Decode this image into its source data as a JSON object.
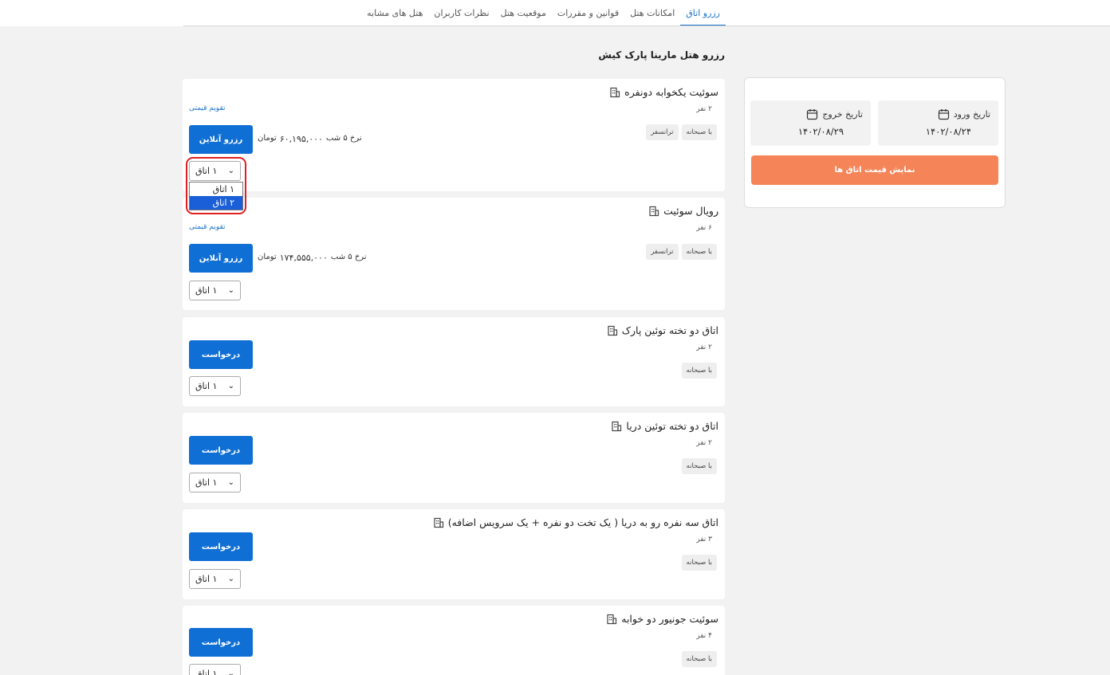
{
  "tabs": [
    {
      "label": "رزرو اتاق",
      "active": true
    },
    {
      "label": "امکانات هتل"
    },
    {
      "label": "قوانین و مقررات"
    },
    {
      "label": "موقعیت هتل"
    },
    {
      "label": "نظرات کاربران"
    },
    {
      "label": "هتل های مشابه"
    }
  ],
  "page_title": "رزرو هتل مارینا پارک کیش",
  "rooms": [
    {
      "title": "سوئیت یکخوابه دونفره",
      "capacity": "۲ نفر",
      "badges": [
        "با صبحانه",
        "ترانسفر"
      ],
      "calendar_link": "تقویم قیمتی",
      "price_label": "نرخ ۵ شب",
      "price_value": "۶۰,۱۹۵,۰۰۰",
      "currency": "تومان",
      "button": "رزرو آنلاین",
      "select_value": "۱ اتاق"
    },
    {
      "title": "رویال سوئیت",
      "capacity": "۶ نفر",
      "badges": [
        "با صبحانه",
        "ترانسفر"
      ],
      "calendar_link": "تقویم قیمتی",
      "price_label": "نرخ ۵ شب",
      "price_value": "۱۷۴,۵۵۵,۰۰۰",
      "currency": "تومان",
      "button": "رزرو آنلاین",
      "select_value": "۱ اتاق"
    },
    {
      "title": "اتاق دو تخته توئین پارک",
      "capacity": "۲ نفر",
      "badges": [
        "با صبحانه"
      ],
      "button": "درخواست",
      "select_value": "۱ اتاق"
    },
    {
      "title": "اتاق دو تخته توئین دریا",
      "capacity": "۲ نفر",
      "badges": [
        "با صبحانه"
      ],
      "button": "درخواست",
      "select_value": "۱ اتاق"
    },
    {
      "title": "اتاق سه نفره رو به دریا ( یک تخت دو نفره + یک سرویس اضافه)",
      "capacity": "۳ نفر",
      "badges": [
        "با صبحانه"
      ],
      "button": "درخواست",
      "select_value": "۱ اتاق"
    },
    {
      "title": "سوئیت جونیور دو خوابه",
      "capacity": "۴ نفر",
      "badges": [
        "با صبحانه"
      ],
      "button": "درخواست",
      "select_value": "۱ اتاق"
    }
  ],
  "dropdown": {
    "options": [
      "۱ اتاق",
      "۲ اتاق"
    ],
    "highlighted": "۲ اتاق"
  },
  "sidebar": {
    "checkin_label": "تاریخ ورود",
    "checkin_value": "۱۴۰۲/۰۸/۲۴",
    "checkout_label": "تاریخ خروج",
    "checkout_value": "۱۴۰۲/۰۸/۲۹",
    "show_prices_button": "نمایش قیمت اتاق ها"
  },
  "colors": {
    "primary": "#0f6fd4",
    "accent": "#f58559",
    "highlight": "#e02020"
  },
  "icons": {
    "room": "building-icon",
    "date": "calendar-icon",
    "select": "chevron-down-icon"
  }
}
